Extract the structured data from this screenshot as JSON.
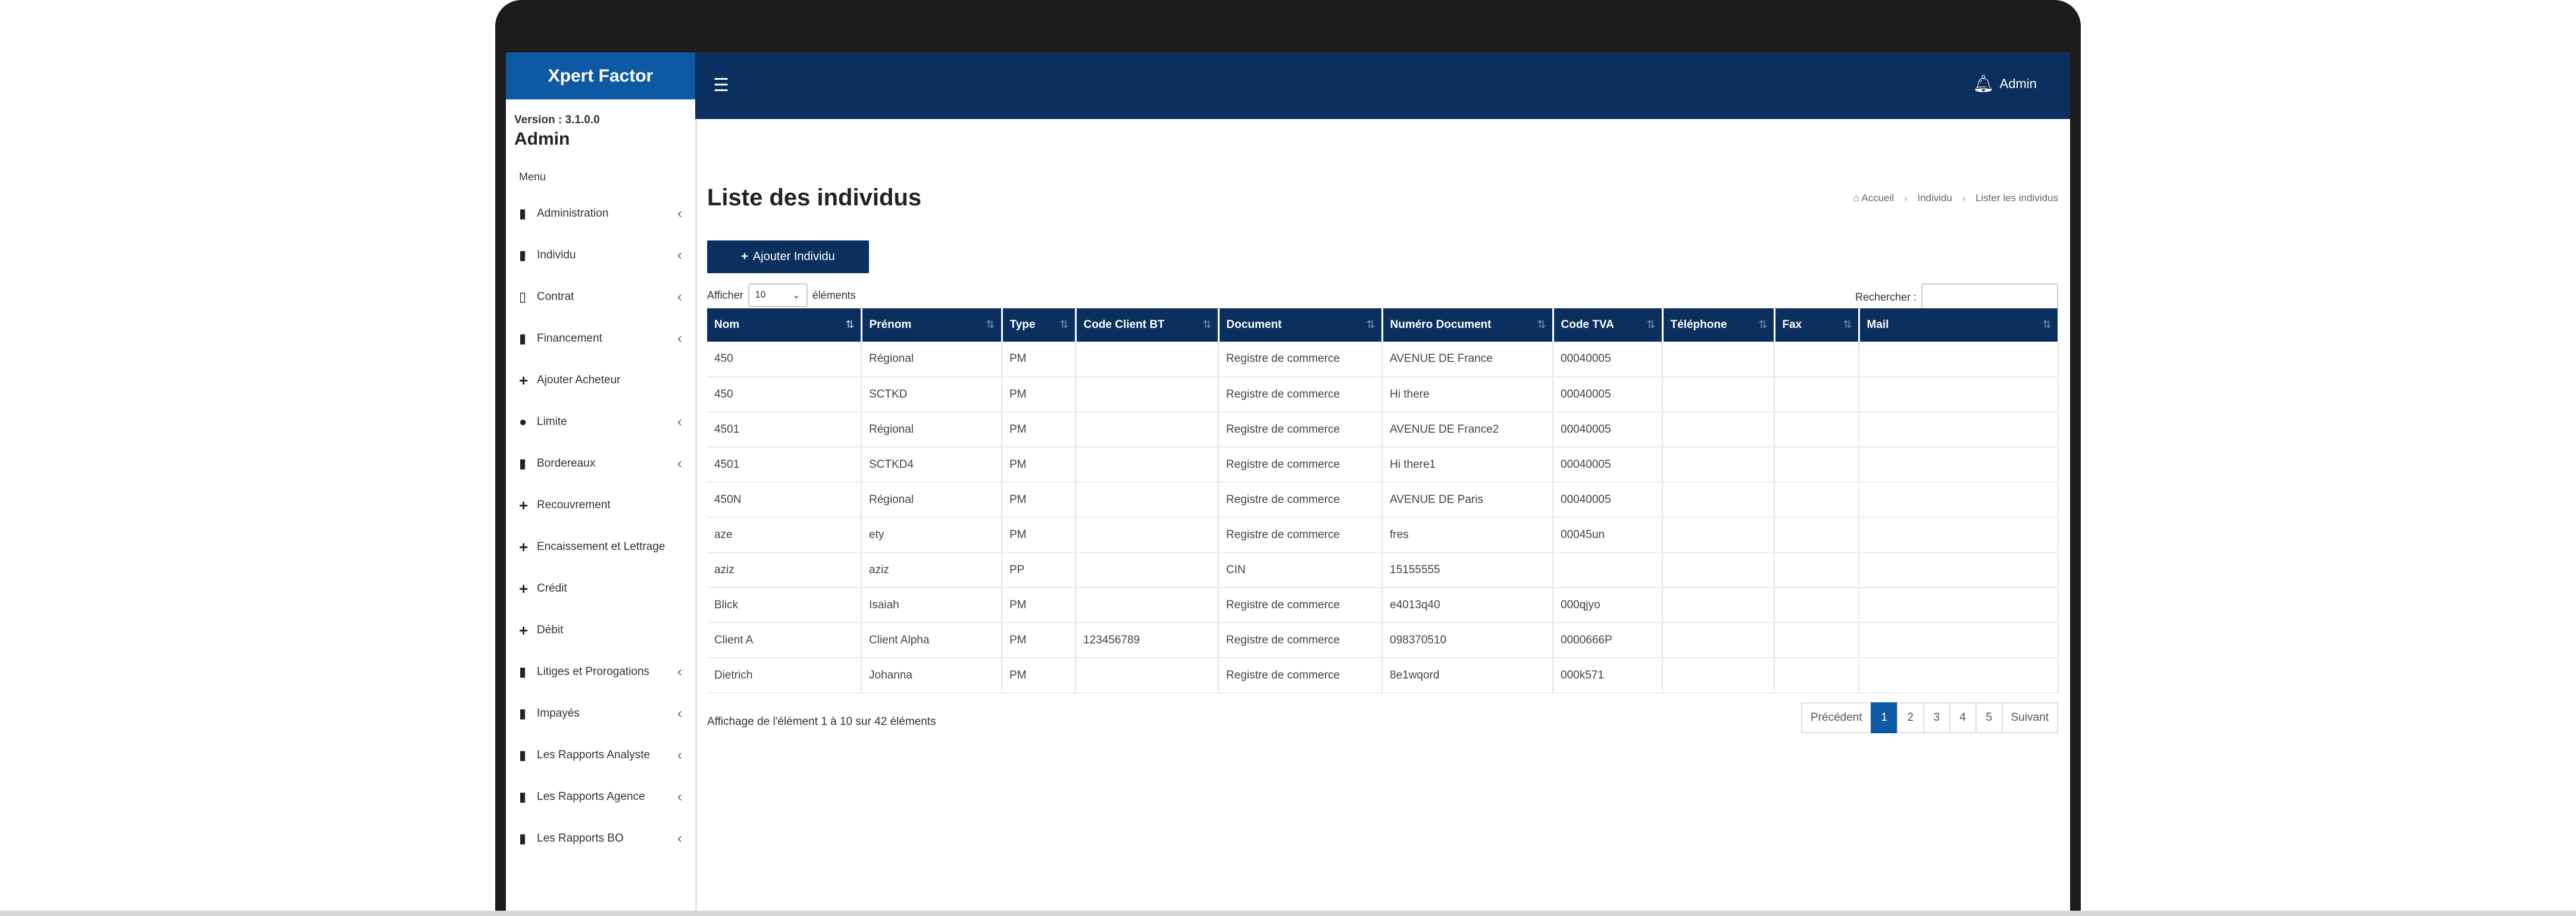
{
  "app": {
    "brand": "Xpert Factor",
    "version": "Version : 3.1.0.0",
    "user": "Admin",
    "menu_header": "Menu"
  },
  "topbar": {
    "menu_icon": "hamburger-icon",
    "notifications_icon": "bell-icon",
    "user": "Admin"
  },
  "sidebar": {
    "items": [
      {
        "label": "Administration",
        "icon": "file-icon",
        "chevron": true
      },
      {
        "label": "Individu",
        "icon": "file-icon",
        "chevron": true
      },
      {
        "label": "Contrat",
        "icon": "file-outline-icon",
        "chevron": true
      },
      {
        "label": "Financement",
        "icon": "file-icon",
        "chevron": true
      },
      {
        "label": "Ajouter Acheteur",
        "icon": "plus-icon",
        "chevron": false
      },
      {
        "label": "Limite",
        "icon": "user-icon",
        "chevron": true
      },
      {
        "label": "Bordereaux",
        "icon": "file-icon",
        "chevron": true
      },
      {
        "label": "Recouvrement",
        "icon": "plus-icon",
        "chevron": false
      },
      {
        "label": "Encaissement et Lettrage",
        "icon": "plus-icon",
        "chevron": false
      },
      {
        "label": "Crédit",
        "icon": "plus-icon",
        "chevron": false
      },
      {
        "label": "Débit",
        "icon": "plus-icon",
        "chevron": false
      },
      {
        "label": "Litiges et Prorogations",
        "icon": "file-icon",
        "chevron": true
      },
      {
        "label": "Impayés",
        "icon": "file-icon",
        "chevron": true
      },
      {
        "label": "Les Rapports Analyste",
        "icon": "file-icon",
        "chevron": true
      },
      {
        "label": "Les Rapports Agence",
        "icon": "file-icon",
        "chevron": true
      },
      {
        "label": "Les Rapports BO",
        "icon": "file-icon",
        "chevron": true
      }
    ]
  },
  "page": {
    "title": "Liste des individus",
    "breadcrumb": [
      "Accueil",
      "Individu",
      "Lister les individus"
    ],
    "add_button": "Ajouter Individu",
    "length_prefix": "Afficher",
    "length_value": "10",
    "length_suffix": "éléments",
    "search_label": "Rechercher :",
    "search_value": ""
  },
  "table": {
    "columns": [
      "Nom",
      "Prénom",
      "Type",
      "Code Client BT",
      "Document",
      "Numéro Document",
      "Code TVA",
      "Téléphone",
      "Fax",
      "Mail"
    ],
    "rows": [
      [
        "450",
        "Régional",
        "PM",
        "",
        "Registre de commerce",
        "AVENUE DE France",
        "00040005",
        "",
        "",
        ""
      ],
      [
        "450",
        "SCTKD",
        "PM",
        "",
        "Registre de commerce",
        "Hi there",
        "00040005",
        "",
        "",
        ""
      ],
      [
        "4501",
        "Régional",
        "PM",
        "",
        "Registre de commerce",
        "AVENUE DE France2",
        "00040005",
        "",
        "",
        ""
      ],
      [
        "4501",
        "SCTKD4",
        "PM",
        "",
        "Registre de commerce",
        "Hi there1",
        "00040005",
        "",
        "",
        ""
      ],
      [
        "450N",
        "Régional",
        "PM",
        "",
        "Registre de commerce",
        "AVENUE DE Paris",
        "00040005",
        "",
        "",
        ""
      ],
      [
        "aze",
        "ety",
        "PM",
        "",
        "Registre de commerce",
        "fres",
        "00045un",
        "",
        "",
        ""
      ],
      [
        "aziz",
        "aziz",
        "PP",
        "",
        "CIN",
        "15155555",
        "",
        "",
        "",
        ""
      ],
      [
        "Blick",
        "Isaiah",
        "PM",
        "",
        "Registre de commerce",
        "e4013q40",
        "000qjyo",
        "",
        "",
        ""
      ],
      [
        "Client A",
        "Client Alpha",
        "PM",
        "123456789",
        "Registre de commerce",
        "098370510",
        "0000666P",
        "",
        "",
        ""
      ],
      [
        "Dietrich",
        "Johanna",
        "PM",
        "",
        "Registre de commerce",
        "8e1wqord",
        "000k571",
        "",
        "",
        ""
      ]
    ]
  },
  "footer": {
    "info": "Affichage de l'élément 1 à 10 sur 42 éléments",
    "prev": "Précédent",
    "pages": [
      "1",
      "2",
      "3",
      "4",
      "5"
    ],
    "active_page": "1",
    "next": "Suivant"
  },
  "colors": {
    "brand": "#0e59a3",
    "navbar": "#0b2f5e",
    "table_header": "#0b2f5e"
  }
}
